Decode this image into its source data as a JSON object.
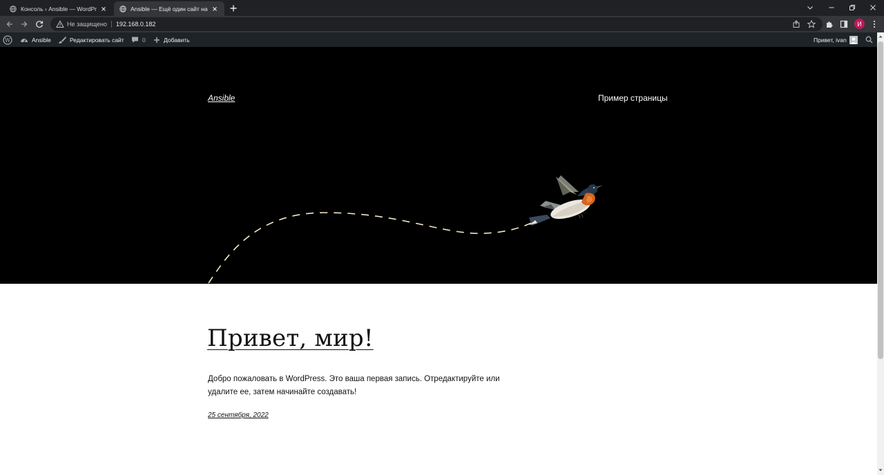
{
  "browser": {
    "tabs": [
      {
        "title": "Консоль ‹ Ansible — WordPress",
        "active": false
      },
      {
        "title": "Ansible — Ещё один сайт на WordPress",
        "active": true
      }
    ],
    "address": {
      "security_label": "Не защищено",
      "url": "192.168.0.182"
    },
    "profile_initial": "И"
  },
  "adminbar": {
    "site_name": "Ansible",
    "customize_label": "Редактировать сайт",
    "comments_count": "0",
    "new_label": "Добавить",
    "greeting": "Привет, ivan"
  },
  "site": {
    "title": "Ansible",
    "nav": [
      "Пример страницы"
    ]
  },
  "post": {
    "title": "Привет, мир!",
    "body": "Добро пожаловать в WordPress. Это ваша первая запись. Отредактируйте или удалите ее, затем начинайте создавать!",
    "date": "25 сентября, 2022"
  },
  "colors": {
    "hero_bg": "#000000",
    "adminbar_bg": "#1d2327",
    "browser_chrome": "#202124",
    "trail": "#f4e6c8"
  }
}
